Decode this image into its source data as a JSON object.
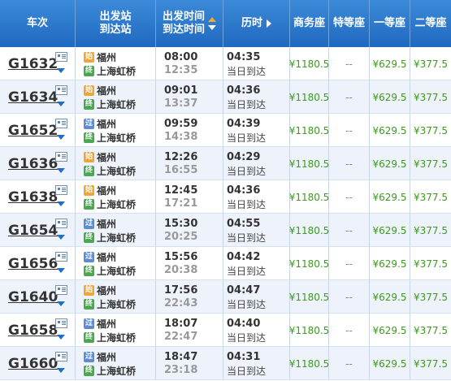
{
  "header": {
    "train": "车次",
    "station_top": "出发站",
    "station_bot": "到达站",
    "time_top": "出发时间",
    "time_bot": "到达时间",
    "duration": "历时",
    "business": "商务座",
    "special": "特等座",
    "first": "一等座",
    "second": "二等座"
  },
  "badges": {
    "start": "始",
    "pass": "过",
    "end": "终"
  },
  "colors": {
    "header": "#2a79cc",
    "price_green": "#3c9a1e",
    "start_badge": "#f0a53a",
    "pass_badge": "#5d8dd0",
    "end_badge": "#4aa84e"
  },
  "rows": [
    {
      "train": "G1632",
      "from_type": "start",
      "from": "福州",
      "to": "上海虹桥",
      "dep": "08:00",
      "arr": "12:35",
      "duration": "04:35",
      "arrive_day": "当日到达",
      "business": "¥1180.5",
      "special": "--",
      "first": "¥629.5",
      "second": "¥377.5"
    },
    {
      "train": "G1634",
      "from_type": "start",
      "from": "福州",
      "to": "上海虹桥",
      "dep": "09:01",
      "arr": "13:37",
      "duration": "04:36",
      "arrive_day": "当日到达",
      "business": "¥1180.5",
      "special": "--",
      "first": "¥629.5",
      "second": "¥377.5"
    },
    {
      "train": "G1652",
      "from_type": "pass",
      "from": "福州",
      "to": "上海虹桥",
      "dep": "09:59",
      "arr": "14:38",
      "duration": "04:39",
      "arrive_day": "当日到达",
      "business": "¥1180.5",
      "special": "--",
      "first": "¥629.5",
      "second": "¥377.5"
    },
    {
      "train": "G1636",
      "from_type": "start",
      "from": "福州",
      "to": "上海虹桥",
      "dep": "12:26",
      "arr": "16:55",
      "duration": "04:29",
      "arrive_day": "当日到达",
      "business": "¥1180.5",
      "special": "--",
      "first": "¥629.5",
      "second": "¥377.5"
    },
    {
      "train": "G1638",
      "from_type": "start",
      "from": "福州",
      "to": "上海虹桥",
      "dep": "12:45",
      "arr": "17:21",
      "duration": "04:36",
      "arrive_day": "当日到达",
      "business": "¥1180.5",
      "special": "--",
      "first": "¥629.5",
      "second": "¥377.5"
    },
    {
      "train": "G1654",
      "from_type": "pass",
      "from": "福州",
      "to": "上海虹桥",
      "dep": "15:30",
      "arr": "20:25",
      "duration": "04:55",
      "arrive_day": "当日到达",
      "business": "¥1180.5",
      "special": "--",
      "first": "¥629.5",
      "second": "¥377.5"
    },
    {
      "train": "G1656",
      "from_type": "pass",
      "from": "福州",
      "to": "上海虹桥",
      "dep": "15:56",
      "arr": "20:38",
      "duration": "04:42",
      "arrive_day": "当日到达",
      "business": "¥1180.5",
      "special": "--",
      "first": "¥629.5",
      "second": "¥377.5"
    },
    {
      "train": "G1640",
      "from_type": "start",
      "from": "福州",
      "to": "上海虹桥",
      "dep": "17:56",
      "arr": "22:43",
      "duration": "04:47",
      "arrive_day": "当日到达",
      "business": "¥1180.5",
      "special": "--",
      "first": "¥629.5",
      "second": "¥377.5"
    },
    {
      "train": "G1658",
      "from_type": "pass",
      "from": "福州",
      "to": "上海虹桥",
      "dep": "18:07",
      "arr": "22:47",
      "duration": "04:40",
      "arrive_day": "当日到达",
      "business": "¥1180.5",
      "special": "--",
      "first": "¥629.5",
      "second": "¥377.5"
    },
    {
      "train": "G1660",
      "from_type": "pass",
      "from": "福州",
      "to": "上海虹桥",
      "dep": "18:47",
      "arr": "23:18",
      "duration": "04:31",
      "arrive_day": "当日到达",
      "business": "¥1180.5",
      "special": "--",
      "first": "¥629.5",
      "second": "¥377.5"
    }
  ]
}
